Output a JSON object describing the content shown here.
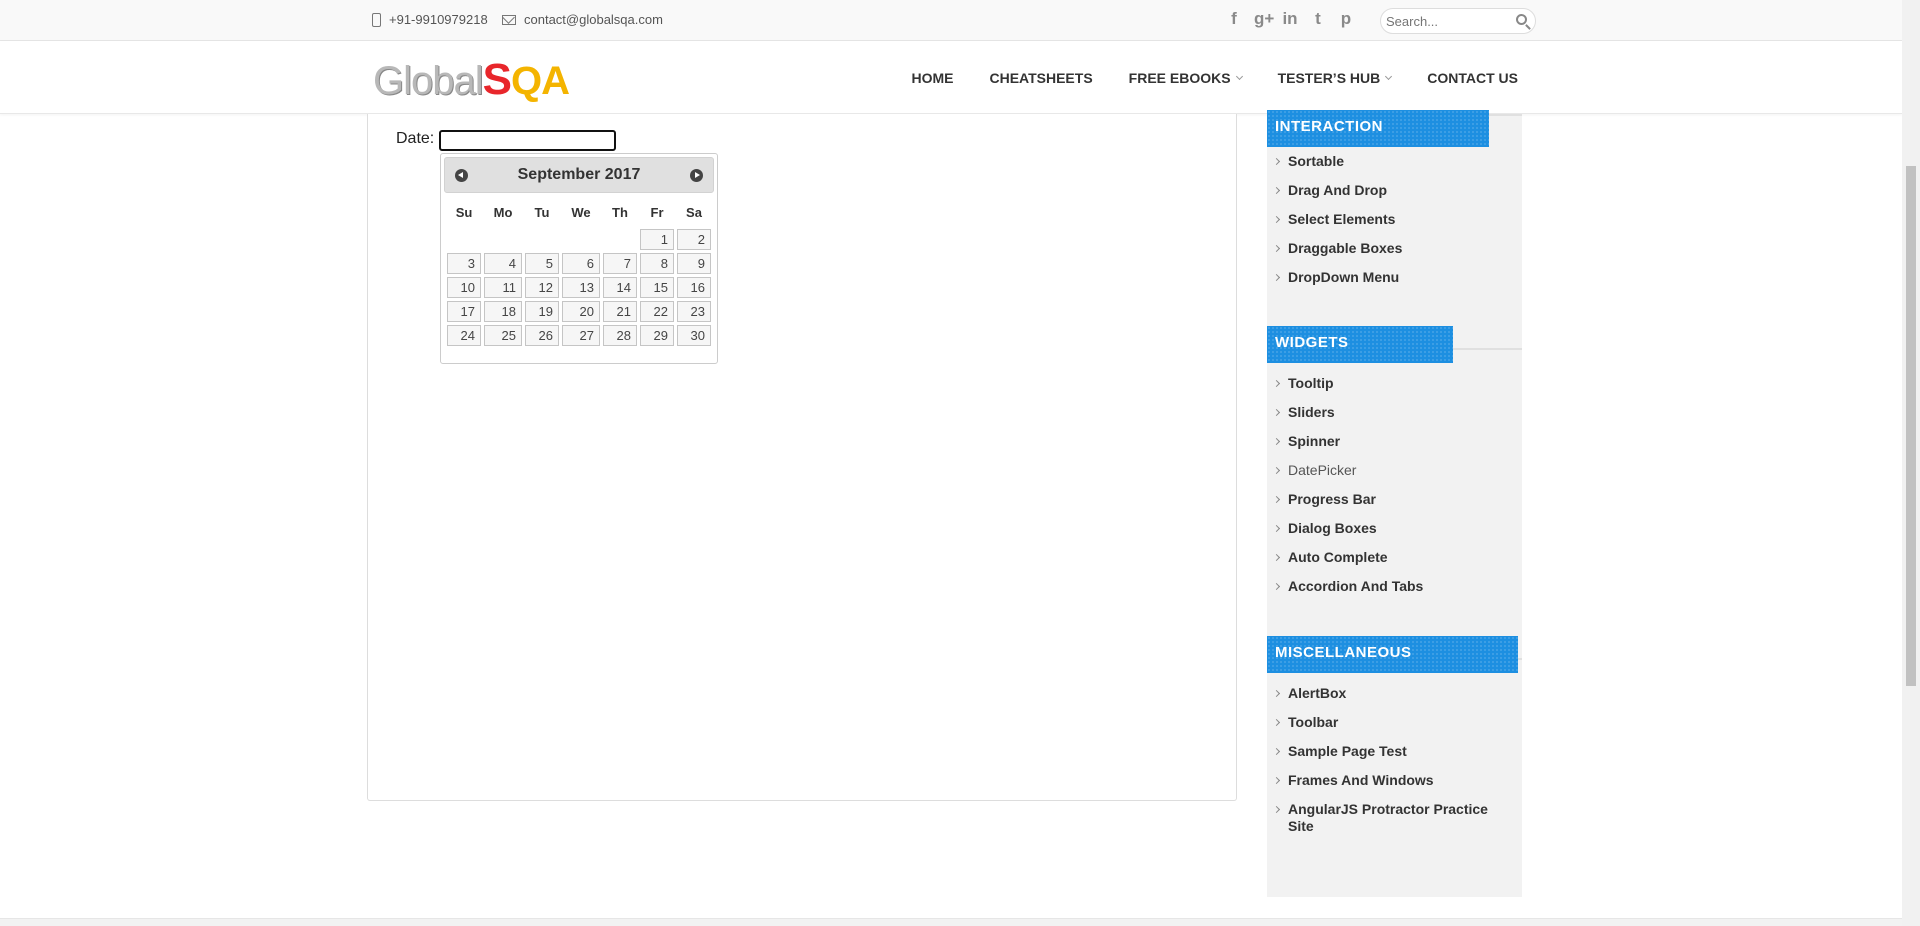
{
  "topbar": {
    "phone": "+91-9910979218",
    "email": "contact@globalsqa.com",
    "social": [
      "f",
      "g+",
      "in",
      "t",
      "p"
    ],
    "search_placeholder": "Search..."
  },
  "header": {
    "logo": {
      "part1": "Global",
      "part2": "S",
      "part3": "QA"
    },
    "nav": [
      {
        "label": "HOME",
        "has_dropdown": false
      },
      {
        "label": "CHEATSHEETS",
        "has_dropdown": false
      },
      {
        "label": "FREE EBOOKS",
        "has_dropdown": true
      },
      {
        "label": "TESTER’S HUB",
        "has_dropdown": true
      },
      {
        "label": "CONTACT US",
        "has_dropdown": false
      }
    ]
  },
  "datepicker": {
    "label": "Date:",
    "input_value": "",
    "month_title": "September 2017",
    "weekdays": [
      "Su",
      "Mo",
      "Tu",
      "We",
      "Th",
      "Fr",
      "Sa"
    ],
    "weeks": [
      [
        "",
        "",
        "",
        "",
        "",
        "1",
        "2"
      ],
      [
        "3",
        "4",
        "5",
        "6",
        "7",
        "8",
        "9"
      ],
      [
        "10",
        "11",
        "12",
        "13",
        "14",
        "15",
        "16"
      ],
      [
        "17",
        "18",
        "19",
        "20",
        "21",
        "22",
        "23"
      ],
      [
        "24",
        "25",
        "26",
        "27",
        "28",
        "29",
        "30"
      ]
    ]
  },
  "sidebar": {
    "interaction": {
      "heading": "INTERACTION",
      "items": [
        "Sortable",
        "Drag And Drop",
        "Select Elements",
        "Draggable Boxes",
        "DropDown Menu"
      ]
    },
    "widgets": {
      "heading": "WIDGETS",
      "items": [
        "Tooltip",
        "Sliders",
        "Spinner",
        "DatePicker",
        "Progress Bar",
        "Dialog Boxes",
        "Auto Complete",
        "Accordion And Tabs"
      ],
      "active": "DatePicker"
    },
    "miscellaneous": {
      "heading": "MISCELLANEOUS",
      "items": [
        "AlertBox",
        "Toolbar",
        "Sample Page Test",
        "Frames And Windows",
        "AngularJS Protractor Practice Site"
      ]
    }
  },
  "colors": {
    "accent_blue": "#1d8fe1",
    "logo_red": "#e8262b",
    "logo_yellow": "#f4b400"
  }
}
